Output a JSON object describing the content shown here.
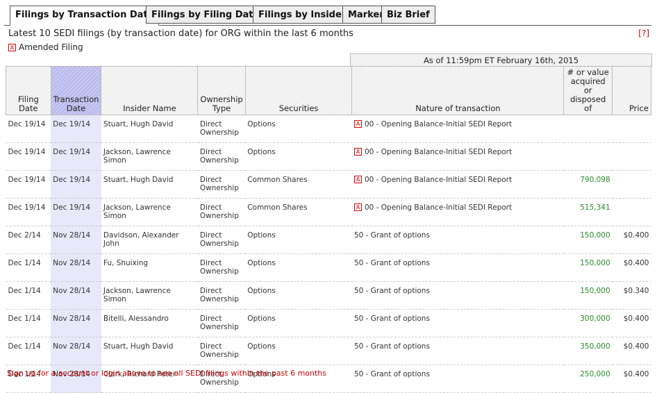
{
  "tabs": [
    "Filings by Transaction Date",
    "Filings by Filing Date",
    "Filings by Insider",
    "Marker",
    "Biz Brief"
  ],
  "title": "Latest 10 SEDI filings (by transaction date) for ORG within the last 6 months",
  "help": "[?]",
  "legend": {
    "icon": "A",
    "label": "Amended Filing"
  },
  "as_of": "As of 11:59pm ET February 16th, 2015",
  "columns": [
    "Filing Date",
    "Transaction Date",
    "Insider Name",
    "Ownership Type",
    "Securities",
    "Nature of transaction",
    "# or value acquired or disposed of",
    "Price"
  ],
  "rows": [
    {
      "filing": "Dec 19/14",
      "trans": "Dec 19/14",
      "insider": "Stuart, Hugh David",
      "own": "Direct Ownership",
      "sec": "Options",
      "amended": true,
      "nature": "00 - Opening Balance-Initial SEDI Report",
      "qty": "",
      "price": ""
    },
    {
      "filing": "Dec 19/14",
      "trans": "Dec 19/14",
      "insider": "Jackson, Lawrence Simon",
      "own": "Direct Ownership",
      "sec": "Options",
      "amended": true,
      "nature": "00 - Opening Balance-Initial SEDI Report",
      "qty": "",
      "price": ""
    },
    {
      "filing": "Dec 19/14",
      "trans": "Dec 19/14",
      "insider": "Stuart, Hugh David",
      "own": "Direct Ownership",
      "sec": "Common Shares",
      "amended": true,
      "nature": "00 - Opening Balance-Initial SEDI Report",
      "qty": "790,098",
      "price": ""
    },
    {
      "filing": "Dec 19/14",
      "trans": "Dec 19/14",
      "insider": "Jackson, Lawrence Simon",
      "own": "Direct Ownership",
      "sec": "Common Shares",
      "amended": true,
      "nature": "00 - Opening Balance-Initial SEDI Report",
      "qty": "515,341",
      "price": ""
    },
    {
      "filing": "Dec 2/14",
      "trans": "Nov 28/14",
      "insider": "Davidson, Alexander John",
      "own": "Direct Ownership",
      "sec": "Options",
      "amended": false,
      "nature": "50 - Grant of options",
      "qty": "150,000",
      "price": "$0.400"
    },
    {
      "filing": "Dec 1/14",
      "trans": "Nov 28/14",
      "insider": "Fu, Shuixing",
      "own": "Direct Ownership",
      "sec": "Options",
      "amended": false,
      "nature": "50 - Grant of options",
      "qty": "150,000",
      "price": "$0.400"
    },
    {
      "filing": "Dec 1/14",
      "trans": "Nov 28/14",
      "insider": "Jackson, Lawrence Simon",
      "own": "Direct Ownership",
      "sec": "Options",
      "amended": false,
      "nature": "50 - Grant of options",
      "qty": "150,000",
      "price": "$0.340"
    },
    {
      "filing": "Dec 1/14",
      "trans": "Nov 28/14",
      "insider": "Bitelli, Alessandro",
      "own": "Direct Ownership",
      "sec": "Options",
      "amended": false,
      "nature": "50 - Grant of options",
      "qty": "300,000",
      "price": "$0.400"
    },
    {
      "filing": "Dec 1/14",
      "trans": "Nov 28/14",
      "insider": "Stuart, Hugh David",
      "own": "Direct Ownership",
      "sec": "Options",
      "amended": false,
      "nature": "50 - Grant of options",
      "qty": "350,000",
      "price": "$0.400"
    },
    {
      "filing": "Dec 1/14",
      "trans": "Nov 28/14",
      "insider": "Clark, Richard Peter",
      "own": "Direct Ownership",
      "sec": "Options",
      "amended": false,
      "nature": "50 - Grant of options",
      "qty": "250,000",
      "price": "$0.400"
    }
  ],
  "footer": "Sign up for a account or login above to see all SEDI filings within the past 6 months"
}
